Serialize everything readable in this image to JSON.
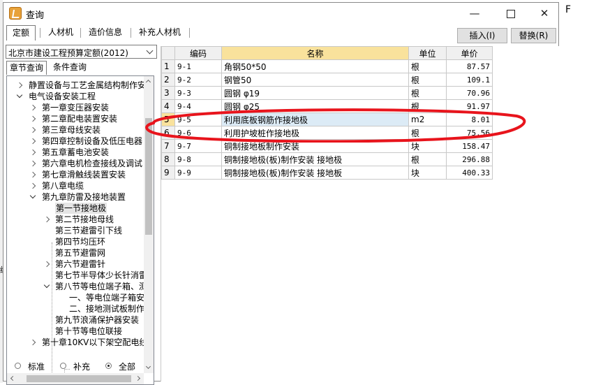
{
  "background": {
    "top_right_char": "F",
    "left_edge_char": "编"
  },
  "window": {
    "title": "查询",
    "controls": {
      "minimize": "—",
      "close": "✕"
    }
  },
  "tabs": [
    {
      "label": "定额",
      "active": true
    },
    {
      "label": "人材机",
      "active": false
    },
    {
      "label": "造价信息",
      "active": false
    },
    {
      "label": "补充人材机",
      "active": false
    }
  ],
  "toolbar": {
    "insert_label": "插入(I)",
    "replace_label": "替换(R)"
  },
  "left": {
    "quota_library": "北京市建设工程预算定额(2012)",
    "subtabs": [
      {
        "label": "章节查询",
        "active": true
      },
      {
        "label": "条件查询",
        "active": false
      }
    ],
    "tree": [
      {
        "label": "静置设备与工艺金属结构制作安",
        "toggle": "collapsed",
        "level": 0
      },
      {
        "label": "电气设备安装工程",
        "toggle": "expanded",
        "level": 0
      },
      {
        "label": "第一章变压器安装",
        "toggle": "collapsed",
        "level": 1
      },
      {
        "label": "第二章配电装置安装",
        "toggle": "collapsed",
        "level": 1
      },
      {
        "label": "第三章母线安装",
        "toggle": "collapsed",
        "level": 1
      },
      {
        "label": "第四章控制设备及低压电器",
        "toggle": "collapsed",
        "level": 1
      },
      {
        "label": "第五章蓄电池安装",
        "toggle": "collapsed",
        "level": 1
      },
      {
        "label": "第六章电机检查接线及调试",
        "toggle": "collapsed",
        "level": 1
      },
      {
        "label": "第七章滑触线装置安装",
        "toggle": "collapsed",
        "level": 1
      },
      {
        "label": "第八章电缆",
        "toggle": "collapsed",
        "level": 1
      },
      {
        "label": "第九章防雷及接地装置",
        "toggle": "expanded",
        "level": 1
      },
      {
        "label": "第一节接地极",
        "toggle": "none",
        "level": 2,
        "selected": true
      },
      {
        "label": "第二节接地母线",
        "toggle": "collapsed",
        "level": 2
      },
      {
        "label": "第三节避雷引下线",
        "toggle": "none",
        "level": 2
      },
      {
        "label": "第四节均压环",
        "toggle": "none",
        "level": 2
      },
      {
        "label": "第五节避雷网",
        "toggle": "none",
        "level": 2
      },
      {
        "label": "第六节避雷针",
        "toggle": "collapsed",
        "level": 2
      },
      {
        "label": "第七节半导体少长针消雷",
        "toggle": "none",
        "level": 2
      },
      {
        "label": "第八节等电位端子箱、测",
        "toggle": "expanded",
        "level": 2
      },
      {
        "label": "一、等电位端子箱安",
        "toggle": "none",
        "level": 3
      },
      {
        "label": "二、接地测试板制作",
        "toggle": "none",
        "level": 3
      },
      {
        "label": "第九节浪涌保护器安装",
        "toggle": "none",
        "level": 2
      },
      {
        "label": "第十节等电位联接",
        "toggle": "none",
        "level": 2
      },
      {
        "label": "第十章10KV以下架空配电线",
        "toggle": "collapsed",
        "level": 1
      }
    ],
    "filters": [
      {
        "label": "标准",
        "checked": false
      },
      {
        "label": "补充",
        "checked": false
      },
      {
        "label": "全部",
        "checked": true
      }
    ]
  },
  "grid": {
    "columns": [
      "",
      "编码",
      "名称",
      "单位",
      "单价"
    ],
    "rows": [
      {
        "no": "1",
        "code": "9-1",
        "name": "角钢50*50",
        "unit": "根",
        "price": "87.57"
      },
      {
        "no": "2",
        "code": "9-2",
        "name": "钢管50",
        "unit": "根",
        "price": "109.1"
      },
      {
        "no": "3",
        "code": "9-3",
        "name": "圆钢 φ19",
        "unit": "根",
        "price": "70.96"
      },
      {
        "no": "4",
        "code": "9-4",
        "name": "圆钢 φ25",
        "unit": "根",
        "price": "91.97"
      },
      {
        "no": "5",
        "code": "9-5",
        "name": "利用底板钢筋作接地极",
        "unit": "m2",
        "price": "8.01",
        "selected": true
      },
      {
        "no": "6",
        "code": "9-6",
        "name": "利用护坡桩作接地极",
        "unit": "根",
        "price": "75.56"
      },
      {
        "no": "7",
        "code": "9-7",
        "name": "铜制接地板制作安装",
        "unit": "块",
        "price": "158.47"
      },
      {
        "no": "8",
        "code": "9-8",
        "name": "铜制接地极(板)制作安装 接地极",
        "unit": "根",
        "price": "296.88"
      },
      {
        "no": "9",
        "code": "9-9",
        "name": "铜制接地极(板)制作安装 接地板",
        "unit": "块",
        "price": "400.33"
      }
    ]
  },
  "annotation": {
    "color": "#e8141c"
  }
}
